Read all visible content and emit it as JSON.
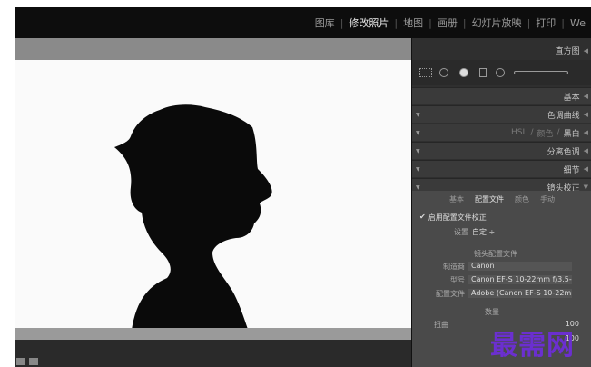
{
  "modules": [
    "图库",
    "修改照片",
    "地图",
    "画册",
    "幻灯片放映",
    "打印",
    "We"
  ],
  "active_module": "修改照片",
  "panel": {
    "histogram_label": "直方图",
    "basic": "基本",
    "tone_curve": "色调曲线",
    "hsl": "HSL",
    "color": "颜色",
    "bw": "黑白",
    "split_toning": "分离色调",
    "detail": "细节",
    "lens_correction": "镜头校正",
    "subtabs": [
      "基本",
      "配置文件",
      "颜色",
      "手动"
    ],
    "enable_profile": "启用配置文件校正",
    "setup_label": "设置",
    "setup_value": "自定 ÷",
    "lens_profile_header": "镜头配置文件",
    "make_label": "制造商",
    "make_value": "Canon",
    "model_label": "型号",
    "model_value": "Canon EF-S 10-22mm f/3.5-4.5...",
    "profile_label": "配置文件",
    "profile_value": "Adobe (Canon EF-S 10-22mm ...",
    "amount_label": "数量",
    "distortion_label": "扭曲",
    "distortion_value": "100",
    "vignette_value": "100"
  },
  "watermark": "最需网"
}
